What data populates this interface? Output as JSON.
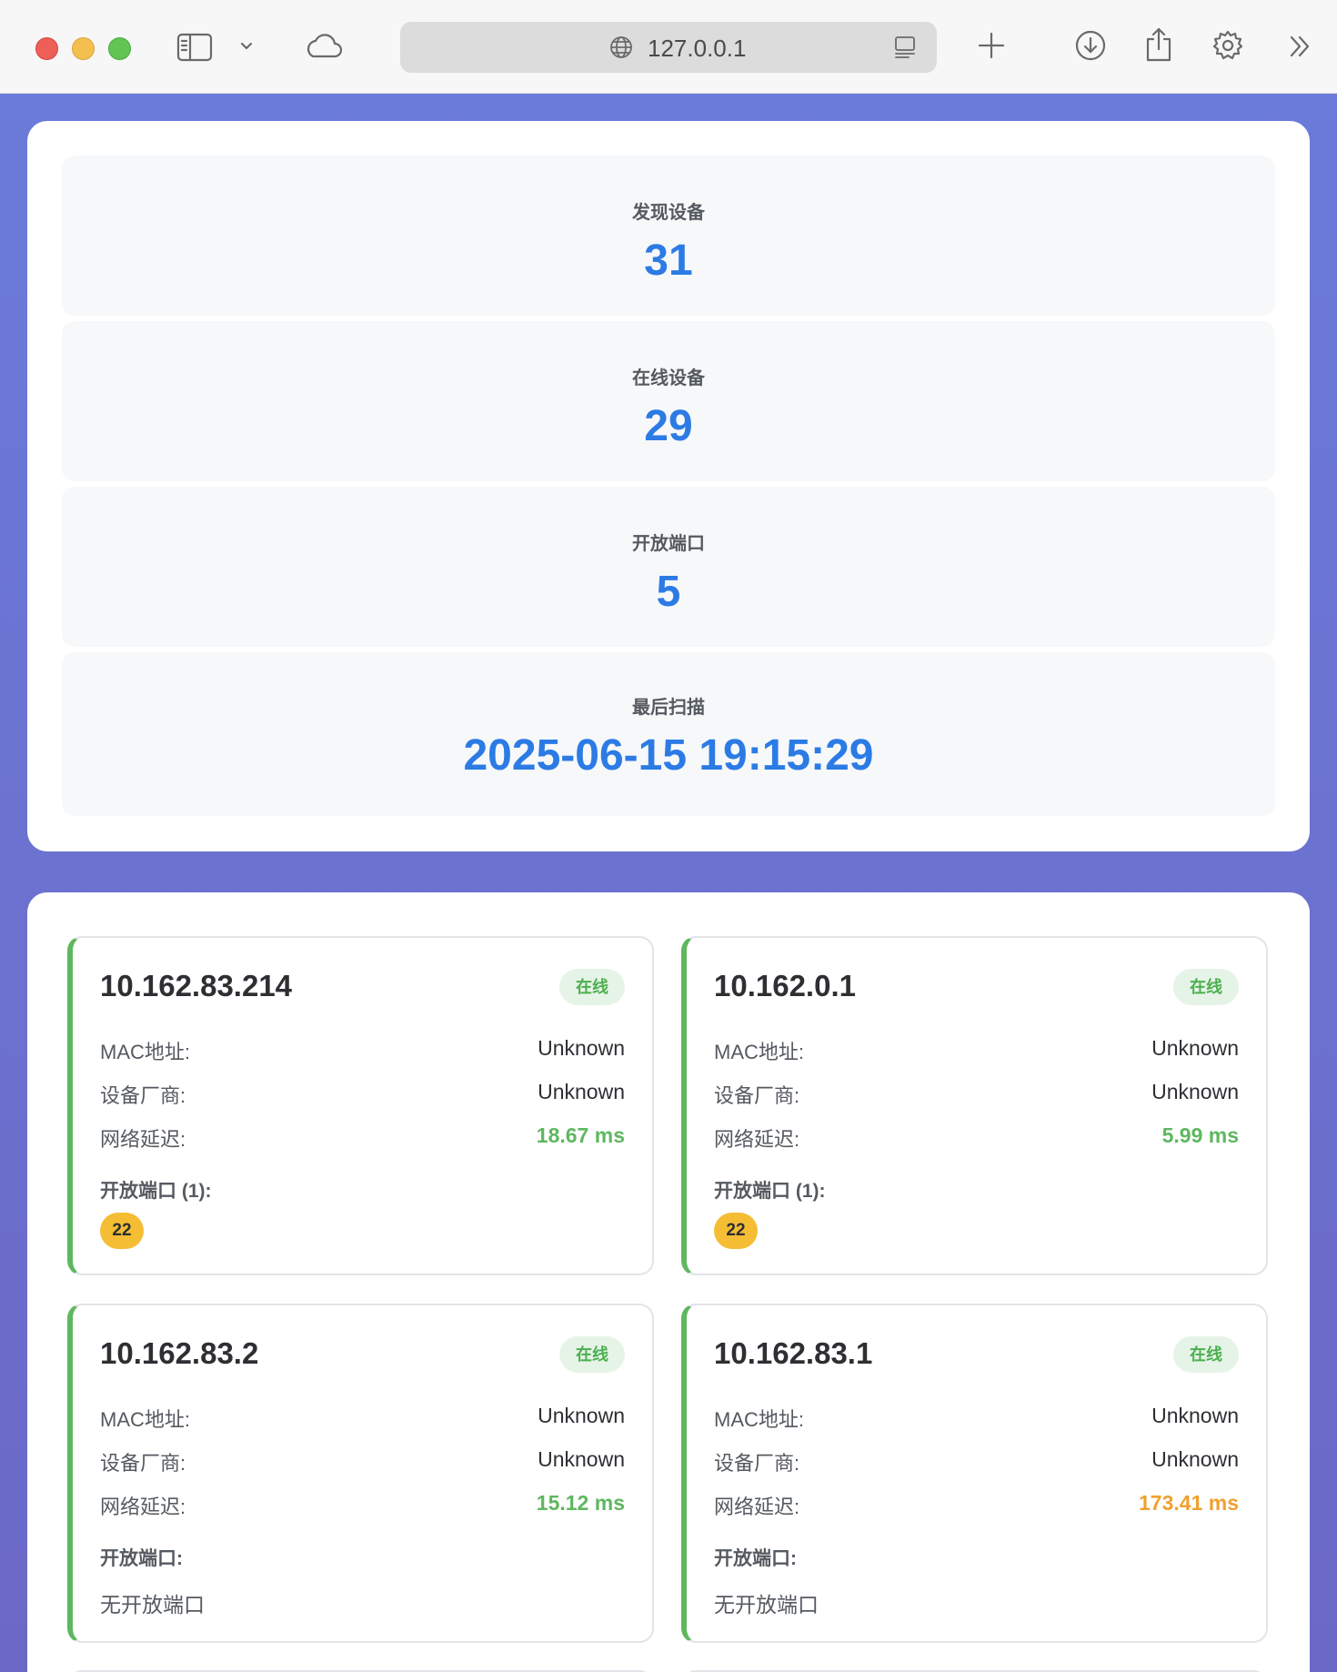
{
  "browser": {
    "url": "127.0.0.1",
    "icons": [
      "sidebar-icon",
      "chevron-down-icon",
      "cloud-icon",
      "globe-icon",
      "reader-icon",
      "plus-icon",
      "download-icon",
      "share-icon",
      "gear-icon",
      "double-chevron-icon"
    ]
  },
  "stats": {
    "discovered": {
      "label": "发现设备",
      "value": "31"
    },
    "online": {
      "label": "在线设备",
      "value": "29"
    },
    "open_ports": {
      "label": "开放端口",
      "value": "5"
    },
    "last_scan": {
      "label": "最后扫描",
      "value": "2025-06-15 19:15:29"
    }
  },
  "labels": {
    "mac": "MAC地址:",
    "vendor": "设备厂商:",
    "latency": "网络延迟:"
  },
  "colors": {
    "accent": "#2c7be5",
    "online": "#4caf50",
    "latency_good": "#5fb760",
    "latency_warn": "#f0a030",
    "port_chip": "#f5bd33"
  },
  "devices": [
    {
      "ip": "10.162.83.214",
      "status": "在线",
      "mac": "Unknown",
      "vendor": "Unknown",
      "latency": "18.67 ms",
      "latency_level": "good",
      "ports_label": "开放端口 (1):",
      "ports": [
        "22"
      ],
      "no_ports_text": ""
    },
    {
      "ip": "10.162.0.1",
      "status": "在线",
      "mac": "Unknown",
      "vendor": "Unknown",
      "latency": "5.99 ms",
      "latency_level": "good",
      "ports_label": "开放端口 (1):",
      "ports": [
        "22"
      ],
      "no_ports_text": ""
    },
    {
      "ip": "10.162.83.2",
      "status": "在线",
      "mac": "Unknown",
      "vendor": "Unknown",
      "latency": "15.12 ms",
      "latency_level": "good",
      "ports_label": "开放端口:",
      "ports": [],
      "no_ports_text": "无开放端口"
    },
    {
      "ip": "10.162.83.1",
      "status": "在线",
      "mac": "Unknown",
      "vendor": "Unknown",
      "latency": "173.41 ms",
      "latency_level": "warn",
      "ports_label": "开放端口:",
      "ports": [],
      "no_ports_text": "无开放端口"
    }
  ]
}
